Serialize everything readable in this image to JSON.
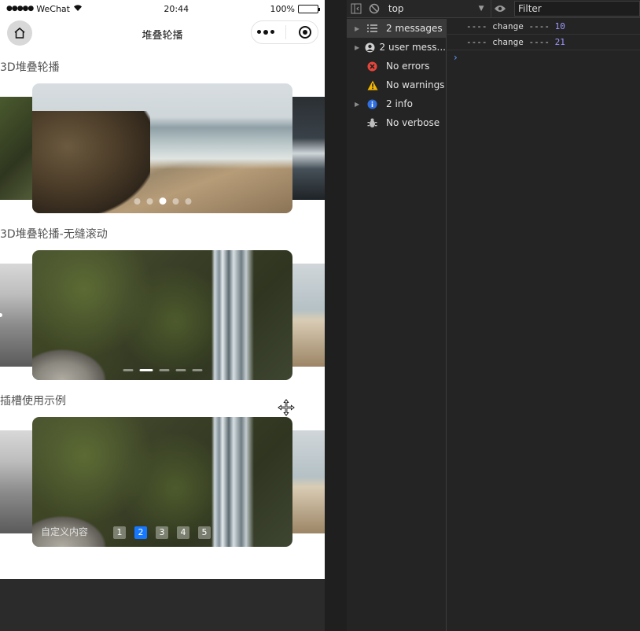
{
  "status_bar": {
    "carrier": "WeChat",
    "time": "20:44",
    "battery": "100%"
  },
  "nav": {
    "title": "堆叠轮播"
  },
  "sections": [
    {
      "title": "3D堆叠轮播",
      "indicator": "dots",
      "count": 5,
      "active_index": 2
    },
    {
      "title": "3D堆叠轮播-无缝滚动",
      "indicator": "bars",
      "count": 5,
      "active_index": 1
    },
    {
      "title": "插槽使用示例",
      "indicator": "numbers",
      "slot_label": "自定义内容",
      "numbers": [
        "1",
        "2",
        "3",
        "4",
        "5"
      ],
      "active_index": 1
    }
  ],
  "devtools": {
    "context": "top",
    "filter_placeholder": "Filter",
    "sidebar": [
      {
        "label": "2 messages",
        "icon": "list-icon",
        "expandable": true,
        "active": true
      },
      {
        "label": "2 user mess...",
        "icon": "user-icon",
        "expandable": true,
        "active": false
      },
      {
        "label": "No errors",
        "icon": "error-icon",
        "expandable": false,
        "active": false
      },
      {
        "label": "No warnings",
        "icon": "warning-icon",
        "expandable": false,
        "active": false
      },
      {
        "label": "2 info",
        "icon": "info-icon",
        "expandable": true,
        "active": false
      },
      {
        "label": "No verbose",
        "icon": "verbose-icon",
        "expandable": false,
        "active": false
      }
    ],
    "logs": [
      {
        "text": "---- change ---- ",
        "a": "1",
        "b": "0"
      },
      {
        "text": "---- change ---- ",
        "a": "2",
        "b": "1"
      }
    ],
    "prompt": "›"
  }
}
